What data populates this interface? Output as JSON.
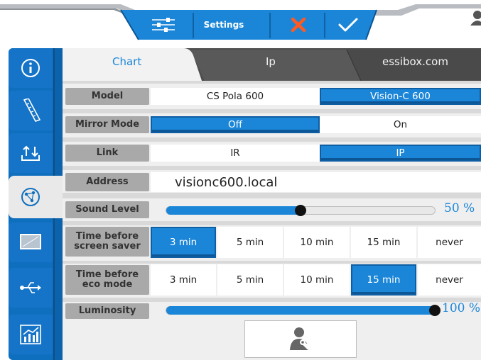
{
  "topbar": {
    "title": "Settings",
    "icons": [
      "sliders-icon",
      "close-icon",
      "check-icon",
      "user-icon"
    ],
    "colors": {
      "bar": "#1b86d8",
      "close": "#ff5a1f",
      "frame": "#9ea3a8"
    }
  },
  "sidebar": {
    "items": [
      {
        "name": "info-icon",
        "selected": false
      },
      {
        "name": "ruler-icon",
        "selected": false
      },
      {
        "name": "upload-download-icon",
        "selected": false
      },
      {
        "name": "network-icon",
        "selected": true
      },
      {
        "name": "display-icon",
        "selected": false
      },
      {
        "name": "usb-icon",
        "selected": false
      },
      {
        "name": "statistics-icon",
        "selected": false
      }
    ],
    "colors": {
      "bg": "#0f6fbf",
      "selected": "#e9e9e9",
      "dark": "#0a4f8a"
    }
  },
  "tabs": [
    {
      "label": "Chart",
      "selected": true
    },
    {
      "label": "Ip",
      "selected": false
    },
    {
      "label": "essibox.com",
      "selected": false
    }
  ],
  "rows": {
    "model": {
      "label": "Model",
      "options": [
        "CS Pola 600",
        "Vision-C 600"
      ],
      "selected": 1
    },
    "mirror": {
      "label": "Mirror Mode",
      "options": [
        "Off",
        "On"
      ],
      "selected": 0
    },
    "link": {
      "label": "Link",
      "options": [
        "IR",
        "IP"
      ],
      "selected": 1
    },
    "address": {
      "label": "Address",
      "value": "visionc600.local"
    },
    "sound": {
      "label": "Sound Level",
      "value_text": "50 %",
      "level": 0.5
    },
    "screensaver": {
      "label": "Time before screen saver",
      "options": [
        "3 min",
        "5 min",
        "10 min",
        "15 min",
        "never"
      ],
      "selected": 0
    },
    "eco": {
      "label": "Time before eco mode",
      "options": [
        "3 min",
        "5 min",
        "10 min",
        "15 min",
        "never"
      ],
      "selected": 3
    },
    "luminosity": {
      "label": "Luminosity",
      "value_text": "100 %",
      "level": 1.0
    }
  },
  "bottom_button": {
    "icon": "user-wrench-icon"
  },
  "accent": "#1b86d8"
}
